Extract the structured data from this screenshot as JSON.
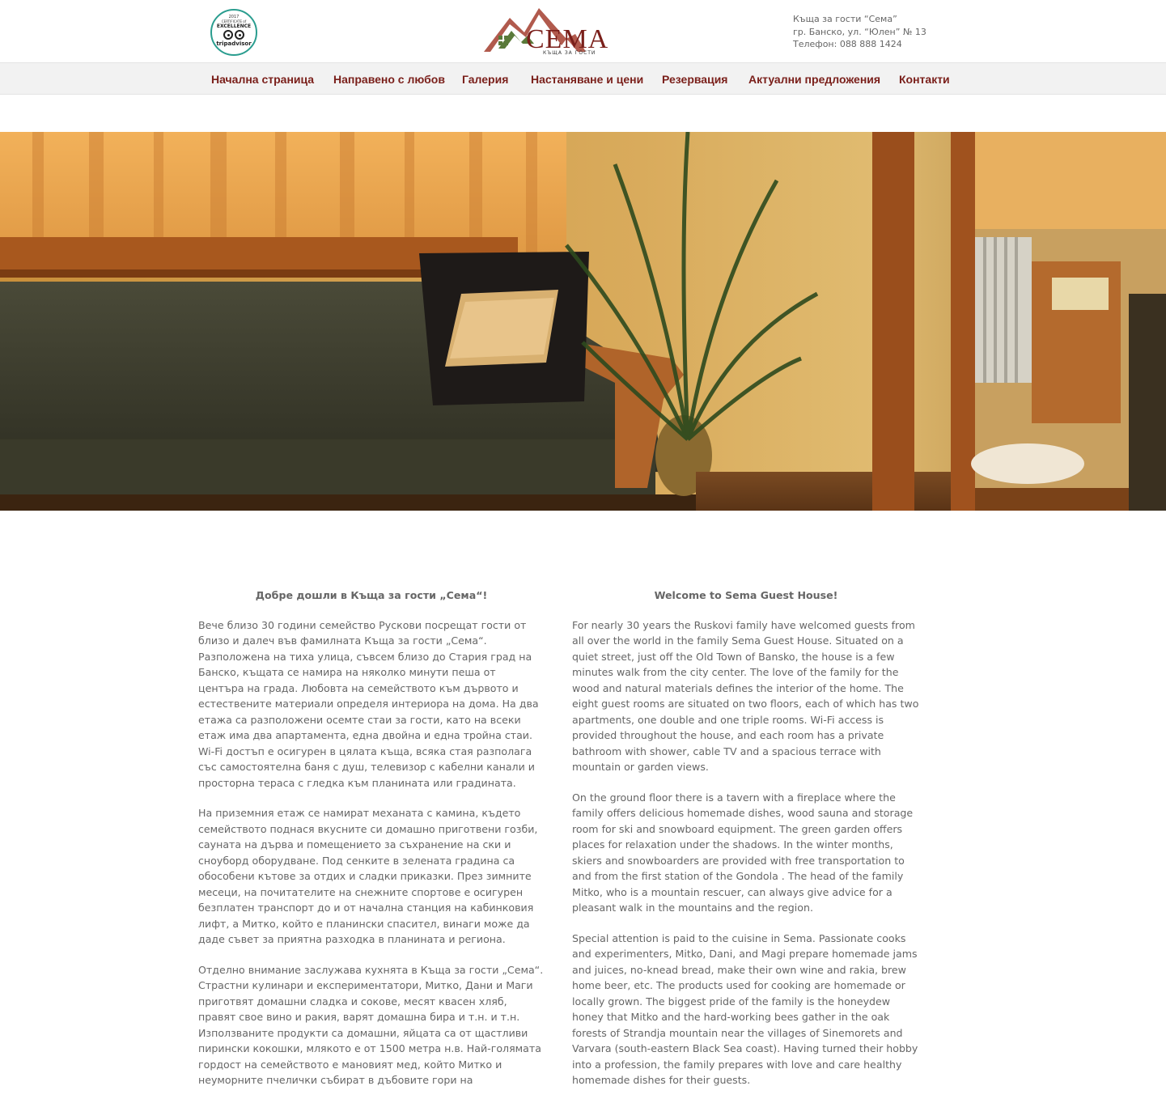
{
  "header": {
    "badge": {
      "year": "2017",
      "certificate": "CERTIFICATE of",
      "excellence": "EXCELLENCE",
      "brand": "tripadvisor"
    },
    "logo": {
      "word": "СЕМА",
      "subtitle": "КЪЩА ЗА ГОСТИ"
    },
    "contact": {
      "name": "Къща за гости “Сема”",
      "address": "гр. Банско, ул. “Юлен” № 13",
      "phone": "Телефон: 088 888 1424"
    }
  },
  "nav": {
    "items": [
      {
        "label": "Начална страница"
      },
      {
        "label": "Направено с любов"
      },
      {
        "label": "Галерия"
      },
      {
        "label": "Настаняване и цени"
      },
      {
        "label": "Резервация"
      },
      {
        "label": "Актуални предложения"
      },
      {
        "label": "Контакти"
      }
    ]
  },
  "content": {
    "bg": {
      "title": "Добре дошли в Къща за гости „Сема“!",
      "paragraphs": [
        "Вече близо 30 години семейство Рускови посрещат гости от близо и далеч във фамилната Къща за гости „Сема“. Разположена на тиха улица, съвсем близо до Стария град на Банско, къщата се намира на няколко минути пеша от центъра на града. Любовта на семейството към дървото и естествените материали определя интериора на дома. На два етажа са разположени осемте стаи за гости, като на всеки етаж има два апартамента, една двойна и една тройна стаи. Wi-Fi достъп е осигурен в цялата къща, всяка стая разполага със самостоятелна баня с душ, телевизор с кабелни канали и просторна тераса с гледка към планината или градината.",
        "На приземния етаж се намират механата с камина, където семейството поднася вкусните си домашно приготвени гозби, сауната на дърва и помещението за съхранение на ски и сноуборд оборудване. Под сенките в зелената градина са обособени кътове за отдих и сладки приказки. През зимните месеци, на почитателите на снежните спортове е осигурен безплатен транспорт до и от начална станция на кабинковия лифт, а Митко, който е планински спасител, винаги може да даде съвет за приятна разходка в планината и региона.",
        "Отделно внимание заслужава кухнята в Къща за гости „Сема“. Страстни кулинари и експериментатори, Митко, Дани и Маги приготвят домашни сладка и сокове, месят квасен хляб, правят свое вино и ракия, варят домашна бира и т.н. и т.н. Използваните продукти са домашни, яйцата са от щастливи пирински кокошки, млякото е от 1500 метра н.в. Най-голямата гордост на семейството е мановият мед, който Митко и неуморните пчелички събират в дъбовите гори на"
      ]
    },
    "en": {
      "title": "Welcome to Sema Guest House!",
      "paragraphs": [
        "For nearly 30 years the Ruskovi family have welcomed guests from all over the world in the family Sema Guest House. Situated on a quiet street, just off the Old Town of Bansko, the house is a few minutes walk from the city center. The love of the family for the wood and natural materials defines the interior of the home. The eight guest rooms are situated on two floors,  each of which has two apartments, one double and one triple rooms. Wi-Fi access is provided throughout the house, and each room has a private bathroom with shower, cable TV and a spacious terrace with mountain or garden views.",
        "On the ground floor there is a tavern with a fireplace where the family offers delicious homemade dishes, wood sauna and storage room for ski and snowboard equipment. The green garden offers places for relaxation under the shadows. In the winter months, skiers and snowboarders are provided with free transportation to and from the first station of the Gondola . The head of the family Mitko, who is a mountain rescuer, can always give advice for a pleasant walk in the mountains and the region.",
        "Special attention is paid to the cuisine in Sema. Passionate cooks and experimenters, Mitko, Dani, and Magi prepare homemade jams and juices, no-knead bread, make their own wine and rakia, brew home beer, etc. The products used for cooking are homemade or locally grown. The biggest pride of the family is the honeydew honey that Mitko and the hard-working bees gather in the oak forests of Strandja mountain near the villages of Sinemorets and Varvara (south-eastern Black Sea coast). Having turned their hobby into a profession, the family prepares with love and care healthy homemade dishes for their guests."
      ]
    }
  },
  "colors": {
    "brand": "#7a1f1a",
    "text": "#666666",
    "nav_bg": "#f2f2f2",
    "logo_green": "#5a7a3a"
  }
}
